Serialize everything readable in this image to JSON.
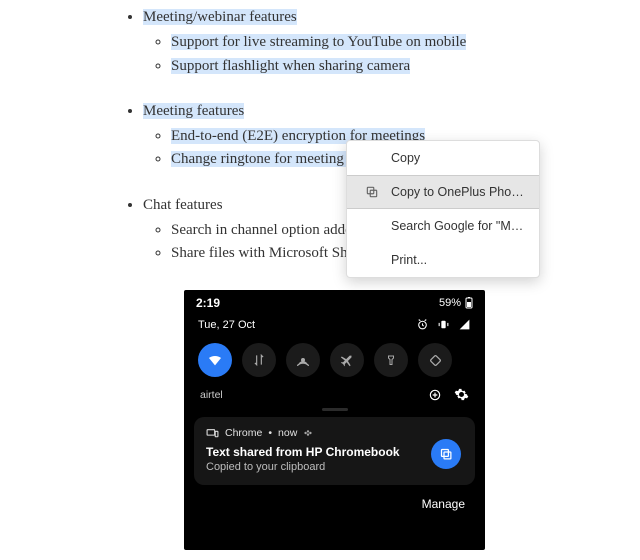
{
  "doc": {
    "section1": {
      "header": "Meeting/webinar features",
      "items": [
        "Support for live streaming to YouTube on mobile",
        "Support flashlight when sharing camera"
      ]
    },
    "section2": {
      "header": "Meeting features",
      "items": [
        "End-to-end (E2E) encryption for meetings",
        "Change ringtone for meeting in"
      ]
    },
    "section3": {
      "header": "Chat features",
      "items": [
        "Search in channel option added",
        "Share files with Microsoft Shar"
      ]
    }
  },
  "contextMenu": {
    "copy": "Copy",
    "copyToDevice": "Copy to OnePlus Phone",
    "searchGoogle": "Search Google for \"Meeting/webinar",
    "print": "Print..."
  },
  "phone": {
    "time": "2:19",
    "battery": "59%",
    "date": "Tue, 27 Oct",
    "networkLabel": "airtel",
    "notification": {
      "app": "Chrome",
      "when": "now",
      "title": "Text shared from HP Chromebook",
      "body": "Copied to your clipboard"
    },
    "manage": "Manage"
  }
}
